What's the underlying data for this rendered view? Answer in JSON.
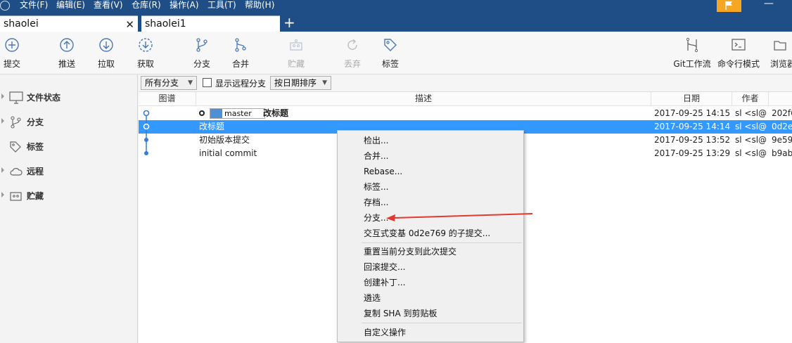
{
  "menubar": {
    "items": [
      "文件(F)",
      "编辑(E)",
      "查看(V)",
      "仓库(R)",
      "操作(A)",
      "工具(T)",
      "帮助(H)"
    ],
    "minimize": "—"
  },
  "tabs": [
    {
      "label": "shaolei",
      "close": "✕"
    },
    {
      "label": "shaolei1"
    }
  ],
  "tab_new": "+",
  "toolbar": {
    "commit": "提交",
    "push": "推送",
    "pull": "拉取",
    "fetch": "获取",
    "branch": "分支",
    "merge": "合并",
    "stash": "贮藏",
    "discard": "丢弃",
    "tag": "标签",
    "git_flow": "Git工作流",
    "terminal": "命令行模式",
    "browse": "浏览器"
  },
  "sidebar": {
    "items": [
      "文件状态",
      "分支",
      "标签",
      "远程",
      "贮藏"
    ]
  },
  "filter": {
    "branches": "所有分支",
    "show_remote": "显示远程分支",
    "sort": "按日期排序"
  },
  "columns": {
    "graph": "图谱",
    "description": "描述",
    "date": "日期",
    "author": "作者"
  },
  "commits": [
    {
      "branch": "master",
      "description": "改标题",
      "date": "2017-09-25 14:15",
      "author": "sl <sl@",
      "hash": "202f6"
    },
    {
      "description": "改标题",
      "date": "2017-09-25 14:14",
      "author": "sl <sl@",
      "hash": "0d2e"
    },
    {
      "description": "初始版本提交",
      "date": "2017-09-25 13:52",
      "author": "sl <sl@",
      "hash": "9e59"
    },
    {
      "description": "initial commit",
      "date": "2017-09-25 13:29",
      "author": "sl <sl@",
      "hash": "b9ab"
    }
  ],
  "context_menu": {
    "items": [
      "检出...",
      "合并...",
      "Rebase...",
      "标签...",
      "存档...",
      "分支...",
      "交互式变基 0d2e769 的子提交...",
      "重置当前分支到此次提交",
      "回滚提交...",
      "创建补丁...",
      "遴选",
      "复制 SHA 到剪贴板",
      "自定义操作"
    ]
  },
  "colors": {
    "titlebar": "#1f4e86",
    "selection": "#3399ff",
    "graph_line": "#3b7bd6",
    "annotation_arrow": "#e03a30",
    "flag": "#f5a623"
  }
}
